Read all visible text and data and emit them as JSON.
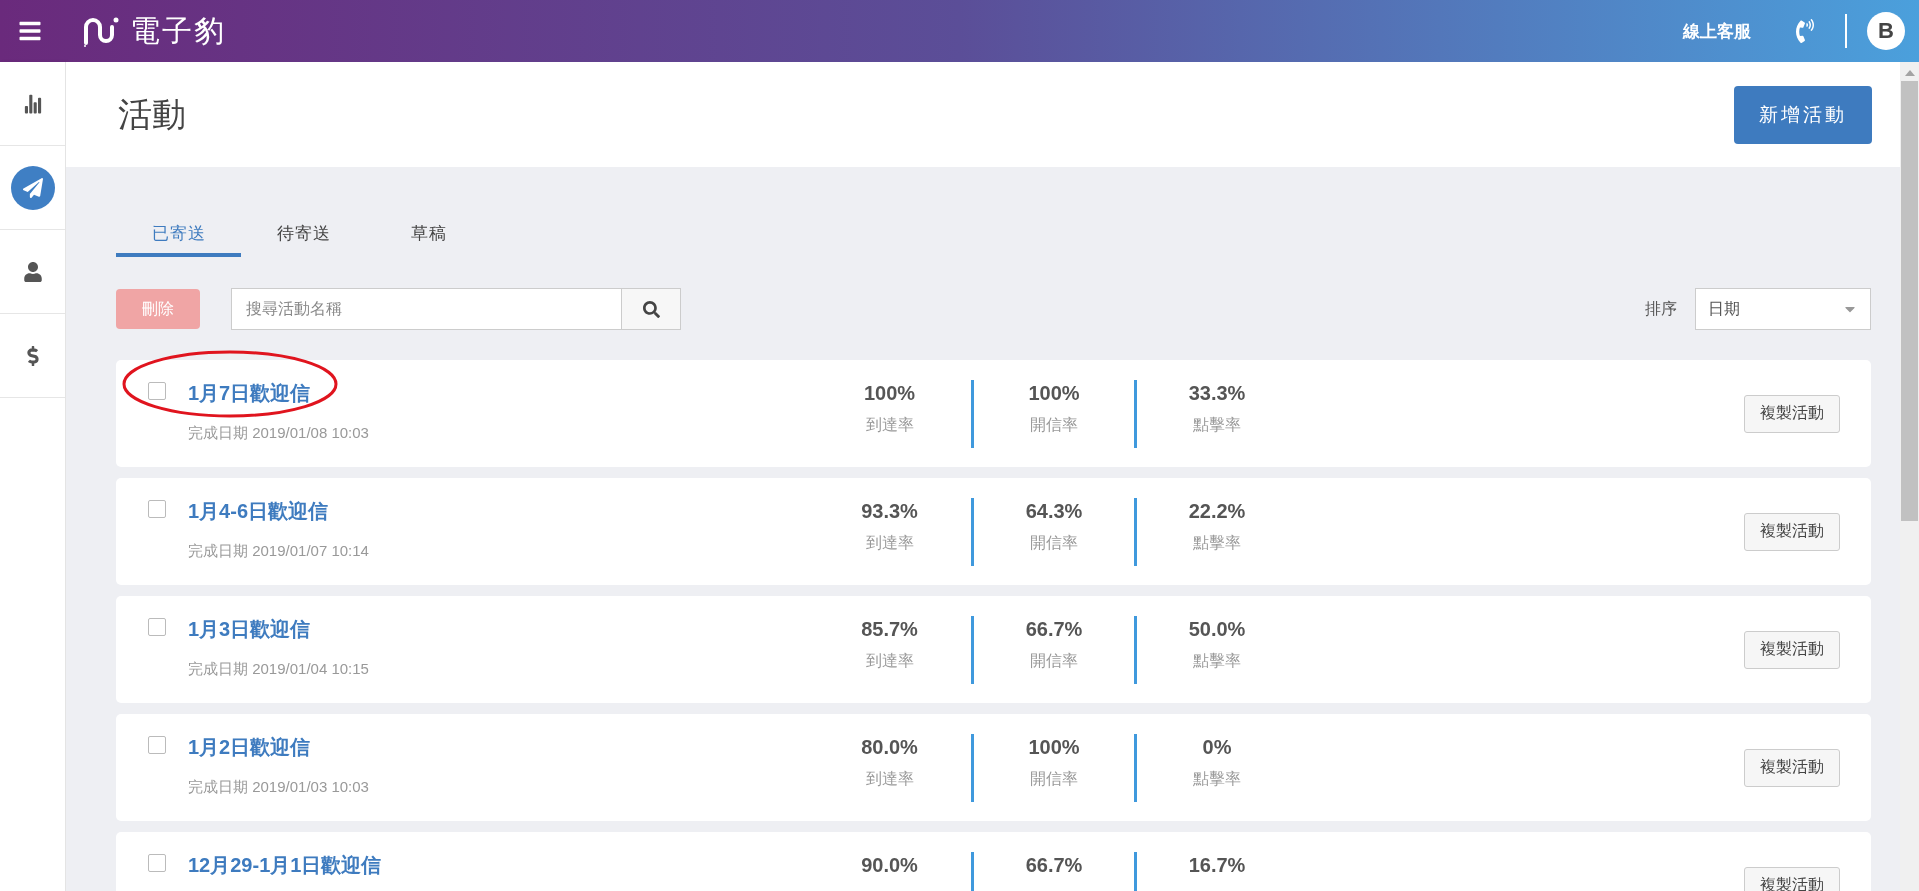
{
  "topbar": {
    "logo_text": "電子豹",
    "support_label": "線上客服",
    "avatar_letter": "B"
  },
  "sidebar": {
    "items": [
      {
        "kind": "chart",
        "selected": false
      },
      {
        "kind": "send",
        "selected": true
      },
      {
        "kind": "user",
        "selected": false
      },
      {
        "kind": "dollar",
        "selected": false
      }
    ]
  },
  "page": {
    "title": "活動",
    "new_button": "新增活動"
  },
  "tabs": [
    {
      "label": "已寄送",
      "selected": true
    },
    {
      "label": "待寄送",
      "selected": false
    },
    {
      "label": "草稿",
      "selected": false
    }
  ],
  "toolbar": {
    "delete_button": "刪除",
    "delete_disabled": true,
    "search": {
      "placeholder": "搜尋活動名稱"
    },
    "sort_label": "排序",
    "sort_value": "日期"
  },
  "campaigns": [
    {
      "name": "1月7日歡迎信",
      "checked": false,
      "highlighted": true,
      "completed": "完成日期 2019/01/08 10:03",
      "stats": [
        {
          "value": "100%",
          "label": "到達率"
        },
        {
          "value": "100%",
          "label": "開信率"
        },
        {
          "value": "33.3%",
          "label": "點擊率"
        }
      ],
      "copy_button": "複製活動"
    },
    {
      "name": "1月4-6日歡迎信",
      "checked": false,
      "highlighted": false,
      "completed": "完成日期 2019/01/07 10:14",
      "stats": [
        {
          "value": "93.3%",
          "label": "到達率"
        },
        {
          "value": "64.3%",
          "label": "開信率"
        },
        {
          "value": "22.2%",
          "label": "點擊率"
        }
      ],
      "copy_button": "複製活動"
    },
    {
      "name": "1月3日歡迎信",
      "checked": false,
      "highlighted": false,
      "completed": "完成日期 2019/01/04 10:15",
      "stats": [
        {
          "value": "85.7%",
          "label": "到達率"
        },
        {
          "value": "66.7%",
          "label": "開信率"
        },
        {
          "value": "50.0%",
          "label": "點擊率"
        }
      ],
      "copy_button": "複製活動"
    },
    {
      "name": "1月2日歡迎信",
      "checked": false,
      "highlighted": false,
      "completed": "完成日期 2019/01/03 10:03",
      "stats": [
        {
          "value": "80.0%",
          "label": "到達率"
        },
        {
          "value": "100%",
          "label": "開信率"
        },
        {
          "value": "0%",
          "label": "點擊率"
        }
      ],
      "copy_button": "複製活動"
    },
    {
      "name": "12月29-1月1日歡迎信",
      "checked": false,
      "highlighted": false,
      "stats": [
        {
          "value": "90.0%"
        },
        {
          "value": "66.7%"
        },
        {
          "value": "16.7%"
        }
      ],
      "copy_button": "複製活動"
    }
  ]
}
